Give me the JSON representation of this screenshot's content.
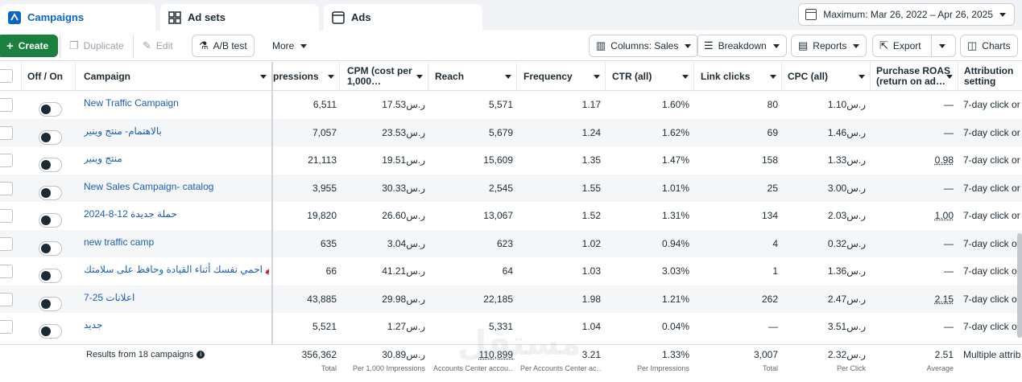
{
  "tabs": [
    {
      "label": "Campaigns",
      "active": true,
      "icon": "campaign-icon"
    },
    {
      "label": "Ad sets",
      "active": false,
      "icon": "adsets-grid-icon"
    },
    {
      "label": "Ads",
      "active": false,
      "icon": "ads-square-icon"
    }
  ],
  "date_range": "Maximum: Mar 26, 2022 – Apr 26, 2025",
  "toolbar": {
    "create": "Create",
    "duplicate": "Duplicate",
    "edit": "Edit",
    "ab_test": "A/B test",
    "more": "More",
    "columns": "Columns: Sales",
    "breakdown": "Breakdown",
    "reports": "Reports",
    "export": "Export",
    "charts": "Charts"
  },
  "columns": {
    "off_on": "Off / On",
    "campaign": "Campaign",
    "impressions": "pressions",
    "cpm": "CPM (cost per",
    "cpm2": "1,000…",
    "reach": "Reach",
    "frequency": "Frequency",
    "ctr": "CTR (all)",
    "link_clicks": "Link clicks",
    "cpc": "CPC (all)",
    "roas": "Purchase ROAS",
    "roas2": "(return on ad…",
    "attribution": "Attribution",
    "attribution2": "setting"
  },
  "rows": [
    {
      "name": "New Traffic Campaign",
      "impressions": "6,511",
      "cpm": "17.53ر.س",
      "reach": "5,571",
      "frequency": "1.17",
      "ctr": "1.60%",
      "link_clicks": "80",
      "cpc": "1.10ر.س",
      "roas": "—",
      "attribution": "7-day click or …"
    },
    {
      "name": "بالاهتمام- منتج وينير",
      "impressions": "7,057",
      "cpm": "23.53ر.س",
      "reach": "5,679",
      "frequency": "1.24",
      "ctr": "1.62%",
      "link_clicks": "69",
      "cpc": "1.46ر.س",
      "roas": "—",
      "attribution": "7-day click or …"
    },
    {
      "name": "منتج وينير",
      "impressions": "21,113",
      "cpm": "19.51ر.س",
      "reach": "15,609",
      "frequency": "1.35",
      "ctr": "1.47%",
      "link_clicks": "158",
      "cpc": "1.33ر.س",
      "roas": "0.98",
      "attribution": "7-day click or …"
    },
    {
      "name": "New Sales Campaign- catalog",
      "impressions": "3,955",
      "cpm": "30.33ر.س",
      "reach": "2,545",
      "frequency": "1.55",
      "ctr": "1.01%",
      "link_clicks": "25",
      "cpc": "3.00ر.س",
      "roas": "—",
      "attribution": "7-day click or …"
    },
    {
      "name": "حملة جديدة 12-8-2024",
      "impressions": "19,820",
      "cpm": "26.60ر.س",
      "reach": "13,067",
      "frequency": "1.52",
      "ctr": "1.31%",
      "link_clicks": "134",
      "cpc": "2.03ر.س",
      "roas": "1.00",
      "attribution": "7-day click or …"
    },
    {
      "name": "new traffic camp",
      "impressions": "635",
      "cpm": "3.04ر.س",
      "reach": "623",
      "frequency": "1.02",
      "ctr": "0.94%",
      "link_clicks": "4",
      "cpc": "0.32ر.س",
      "roas": "—",
      "attribution": "7-day click or …"
    },
    {
      "name": "احمي نفسك أثناء القيادة وحافظ على سلامتك 🚗🚗",
      "impressions": "66",
      "cpm": "41.21ر.س",
      "reach": "64",
      "frequency": "1.03",
      "ctr": "3.03%",
      "link_clicks": "1",
      "cpc": "1.36ر.س",
      "roas": "—",
      "attribution": "7-day click or …"
    },
    {
      "name": "اعلانات 25-7",
      "impressions": "43,885",
      "cpm": "29.98ر.س",
      "reach": "22,185",
      "frequency": "1.98",
      "ctr": "1.21%",
      "link_clicks": "262",
      "cpc": "2.47ر.س",
      "roas": "2.15",
      "attribution": "7-day click or …"
    },
    {
      "name": "جديد",
      "impressions": "5,521",
      "cpm": "1.27ر.س",
      "reach": "5,331",
      "frequency": "1.04",
      "ctr": "0.04%",
      "link_clicks": "—",
      "cpc": "3.51ر.س",
      "roas": "—",
      "attribution": "7-day click or …"
    }
  ],
  "footer": {
    "results": "Results from 18 campaigns",
    "impressions": "356,362",
    "impressions_sub": "Total",
    "cpm": "30.89ر.س",
    "cpm_sub": "Per 1,000 Impressions",
    "reach": "110,899",
    "reach_sub": "Accounts Center accou…",
    "frequency": "3.21",
    "frequency_sub": "Per Accounts Center ac…",
    "ctr": "1.33%",
    "ctr_sub": "Per Impressions",
    "link_clicks": "3,007",
    "link_clicks_sub": "Total",
    "cpc": "2.32ر.س",
    "cpc_sub": "Per Click",
    "roas": "2.51",
    "roas_sub": "Average",
    "attribution": "Multiple attrib…"
  },
  "watermark": "مستقل",
  "colors": {
    "accent": "#0a66c2",
    "create": "#1b7f3d",
    "link": "#1a5fb4"
  }
}
